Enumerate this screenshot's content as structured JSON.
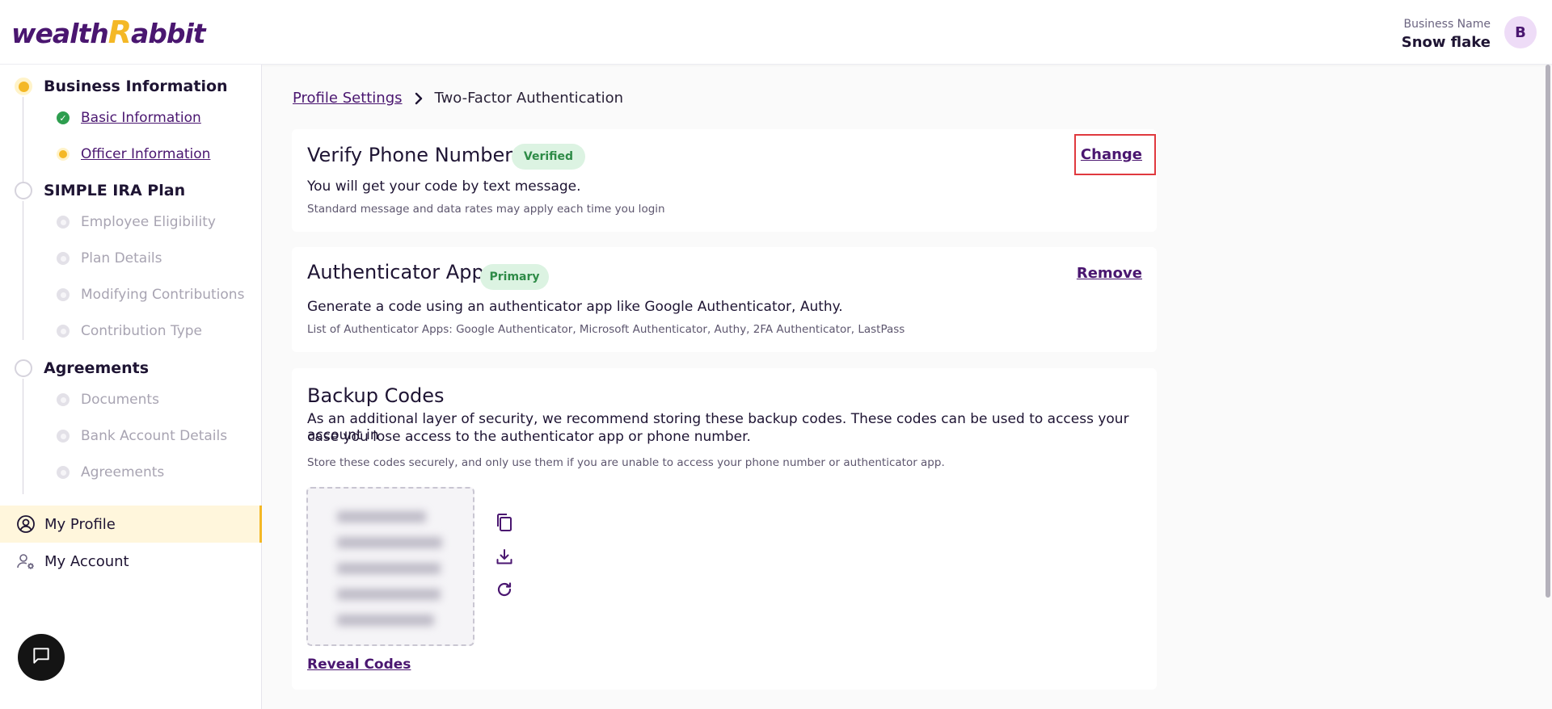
{
  "header": {
    "logo_text_1": "wealth",
    "logo_text_r": "R",
    "logo_text_2": "abbit",
    "business_label": "Business Name",
    "business_name": "Snow flake",
    "avatar_initial": "B"
  },
  "sidebar": {
    "sections": [
      {
        "label": "Business Information",
        "items": [
          "Basic Information",
          "Officer Information"
        ]
      },
      {
        "label": "SIMPLE IRA Plan",
        "items": [
          "Employee Eligibility",
          "Plan Details",
          "Modifying Contributions",
          "Contribution Type"
        ]
      },
      {
        "label": "Agreements",
        "items": [
          "Documents",
          "Bank Account Details",
          "Agreements"
        ]
      }
    ],
    "nav": [
      {
        "label": "My Profile",
        "icon": "user-circle-icon"
      },
      {
        "label": "My Account",
        "icon": "user-gear-icon"
      }
    ]
  },
  "breadcrumb": {
    "parent": "Profile Settings",
    "current": "Two-Factor Authentication"
  },
  "phone_card": {
    "title": "Verify Phone Number",
    "badge": "Verified",
    "action": "Change",
    "description": "You will get your code by text message.",
    "note": "Standard message and data rates may apply each time you login"
  },
  "auth_card": {
    "title": "Authenticator App",
    "badge": "Primary",
    "action": "Remove",
    "description": "Generate a code using an authenticator app like Google Authenticator, Authy.",
    "note": "List of Authenticator Apps: Google Authenticator, Microsoft Authenticator, Authy, 2FA Authenticator, LastPass"
  },
  "backup_card": {
    "title": "Backup Codes",
    "description_1": "As an additional layer of security, we recommend storing these backup codes. These codes can be used to access your account in",
    "description_2": "case you lose access to the authenticator app or phone number.",
    "note": "Store these codes securely, and only use them if you are unable to access your phone number or authenticator app.",
    "reveal_label": "Reveal Codes",
    "tools": [
      "copy-icon",
      "download-icon",
      "refresh-icon"
    ]
  },
  "colors": {
    "brand_purple": "#4a1670",
    "brand_yellow": "#f4b826",
    "success_green": "#2e9e4f",
    "highlight_red": "#e0393e"
  }
}
